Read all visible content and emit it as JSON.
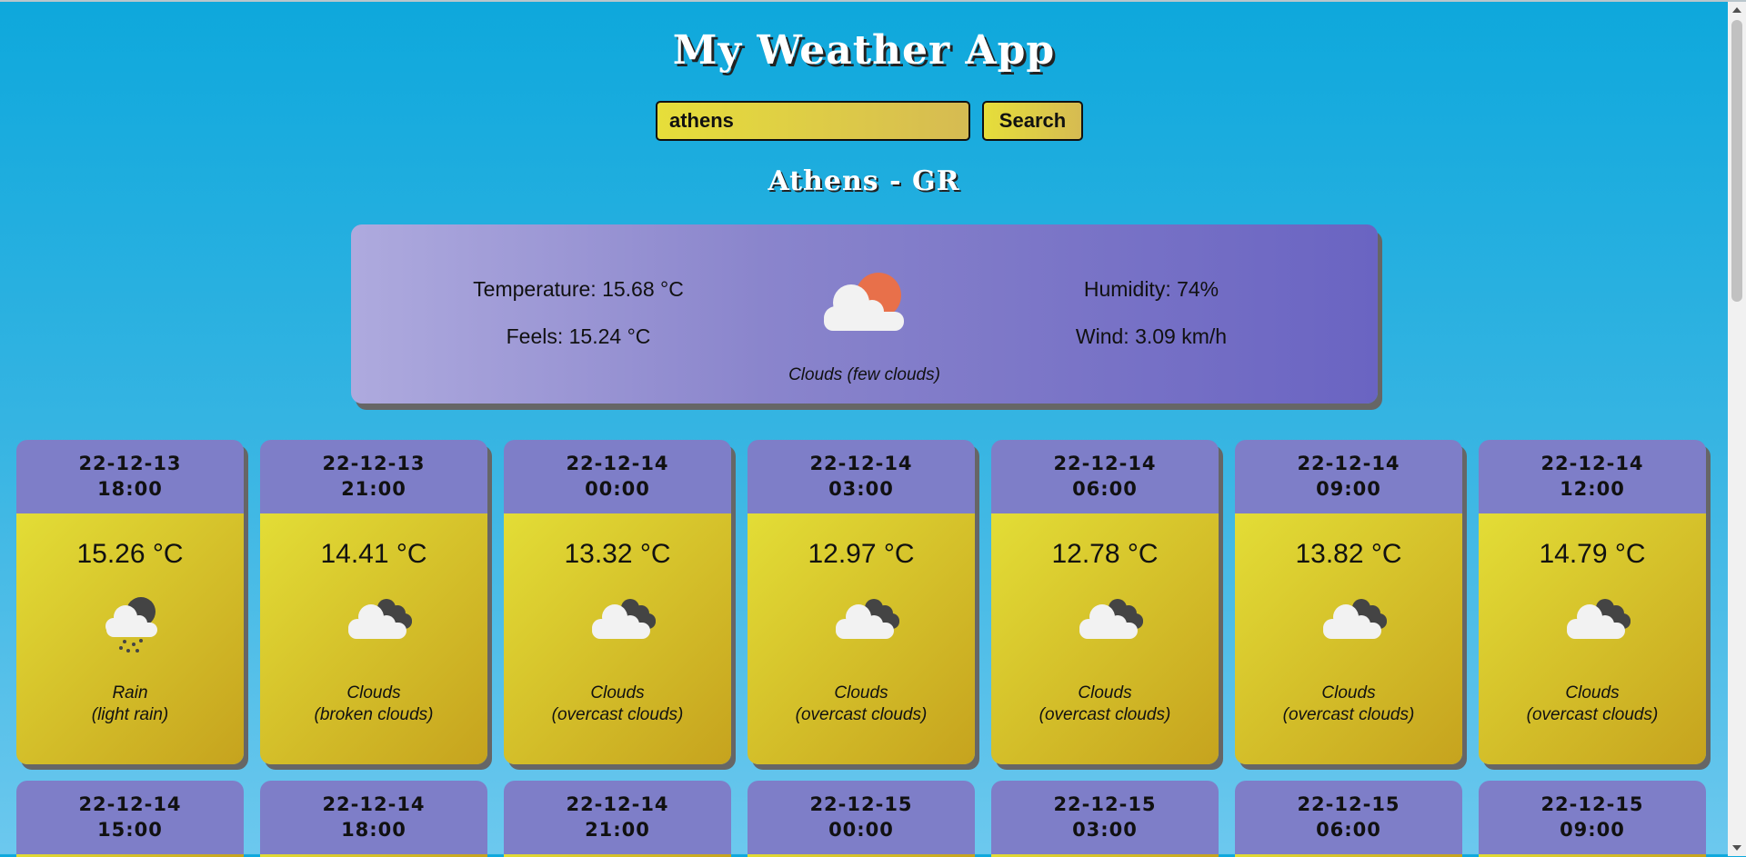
{
  "app": {
    "title": "My Weather App"
  },
  "search": {
    "value": "athens",
    "button_label": "Search"
  },
  "location": "Athens - GR",
  "current": {
    "temperature": "Temperature: 15.68 °C",
    "feels": "Feels: 15.24 °C",
    "humidity": "Humidity: 74%",
    "wind": "Wind: 3.09 km/h",
    "description": "Clouds (few clouds)",
    "icon": "few-clouds-day-icon"
  },
  "colors": {
    "sun": "#e8704a",
    "cloud": "#f2f2f2",
    "dark_cloud": "#444444",
    "header": "#7e7ec8"
  },
  "forecast": [
    {
      "date": "22-12-13",
      "time": "18:00",
      "temp": "15.26 °C",
      "main": "Rain",
      "detail": "(light rain)",
      "icon": "rain-icon"
    },
    {
      "date": "22-12-13",
      "time": "21:00",
      "temp": "14.41 °C",
      "main": "Clouds",
      "detail": "(broken clouds)",
      "icon": "broken-clouds-icon"
    },
    {
      "date": "22-12-14",
      "time": "00:00",
      "temp": "13.32 °C",
      "main": "Clouds",
      "detail": "(overcast clouds)",
      "icon": "overcast-clouds-icon"
    },
    {
      "date": "22-12-14",
      "time": "03:00",
      "temp": "12.97 °C",
      "main": "Clouds",
      "detail": "(overcast clouds)",
      "icon": "overcast-clouds-icon"
    },
    {
      "date": "22-12-14",
      "time": "06:00",
      "temp": "12.78 °C",
      "main": "Clouds",
      "detail": "(overcast clouds)",
      "icon": "overcast-clouds-icon"
    },
    {
      "date": "22-12-14",
      "time": "09:00",
      "temp": "13.82 °C",
      "main": "Clouds",
      "detail": "(overcast clouds)",
      "icon": "overcast-clouds-icon"
    },
    {
      "date": "22-12-14",
      "time": "12:00",
      "temp": "14.79 °C",
      "main": "Clouds",
      "detail": "(overcast clouds)",
      "icon": "overcast-clouds-icon"
    },
    {
      "date": "22-12-14",
      "time": "15:00"
    },
    {
      "date": "22-12-14",
      "time": "18:00"
    },
    {
      "date": "22-12-14",
      "time": "21:00"
    },
    {
      "date": "22-12-15",
      "time": "00:00"
    },
    {
      "date": "22-12-15",
      "time": "03:00"
    },
    {
      "date": "22-12-15",
      "time": "06:00"
    },
    {
      "date": "22-12-15",
      "time": "09:00"
    }
  ]
}
